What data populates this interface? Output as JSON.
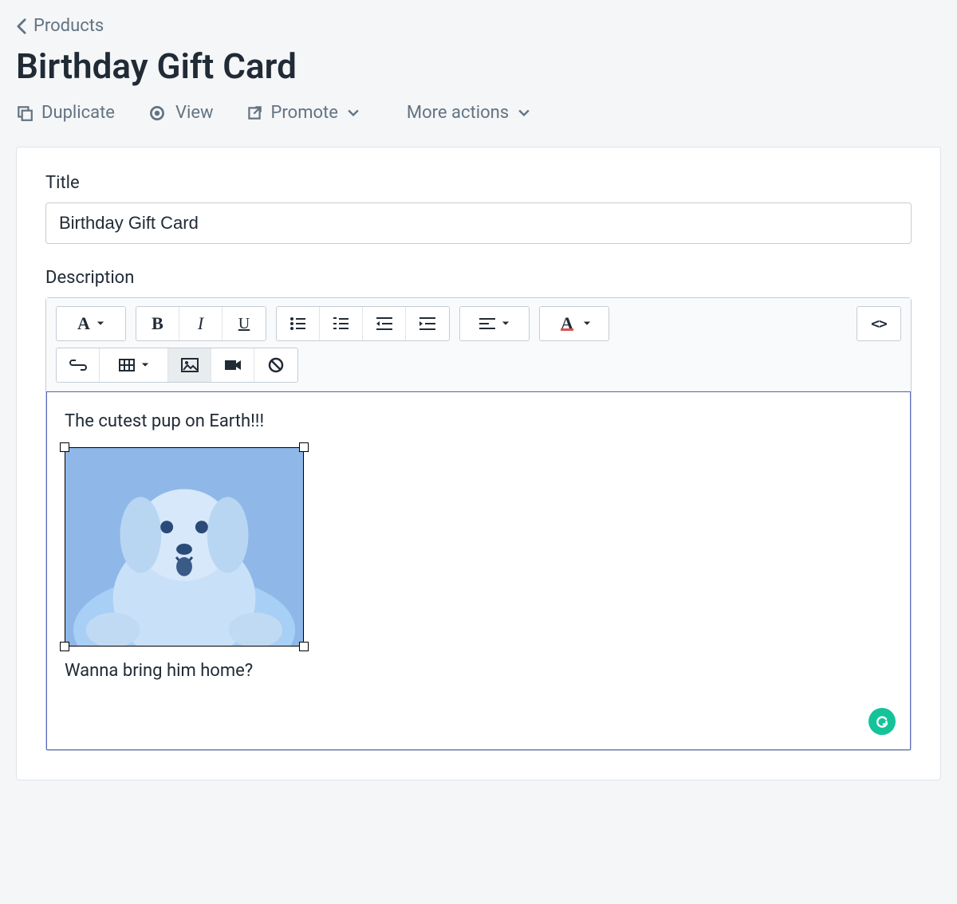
{
  "breadcrumb": {
    "label": "Products"
  },
  "page_title": "Birthday Gift Card",
  "actions": {
    "duplicate": "Duplicate",
    "view": "View",
    "promote": "Promote",
    "more": "More actions"
  },
  "form": {
    "title_label": "Title",
    "title_value": "Birthday Gift Card",
    "description_label": "Description"
  },
  "rte": {
    "content_line1": "The cutest pup on Earth!!!",
    "content_line2": "Wanna bring him home?",
    "image_alt": "selected puppy image"
  },
  "toolbar": {
    "font": "A",
    "bold": "B",
    "italic": "I",
    "underline": "U",
    "color": "A",
    "code": "<>"
  },
  "colors": {
    "accent": "#5c6ac4",
    "grammarly": "#15c39a"
  }
}
